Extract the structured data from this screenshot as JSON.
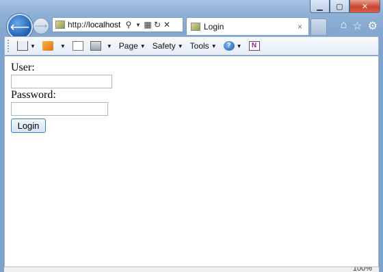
{
  "browser": {
    "address_prefix": "http://",
    "address_host": "localhost",
    "tab_title": "Login",
    "tab_close": "×",
    "zoom": "100%"
  },
  "commandbar": {
    "page_label": "Page",
    "safety_label": "Safety",
    "tools_label": "Tools",
    "help_glyph": "?",
    "onenote_glyph": "N"
  },
  "form": {
    "user_label": "User:",
    "user_value": "",
    "password_label": "Password:",
    "password_value": "",
    "login_label": "Login"
  }
}
